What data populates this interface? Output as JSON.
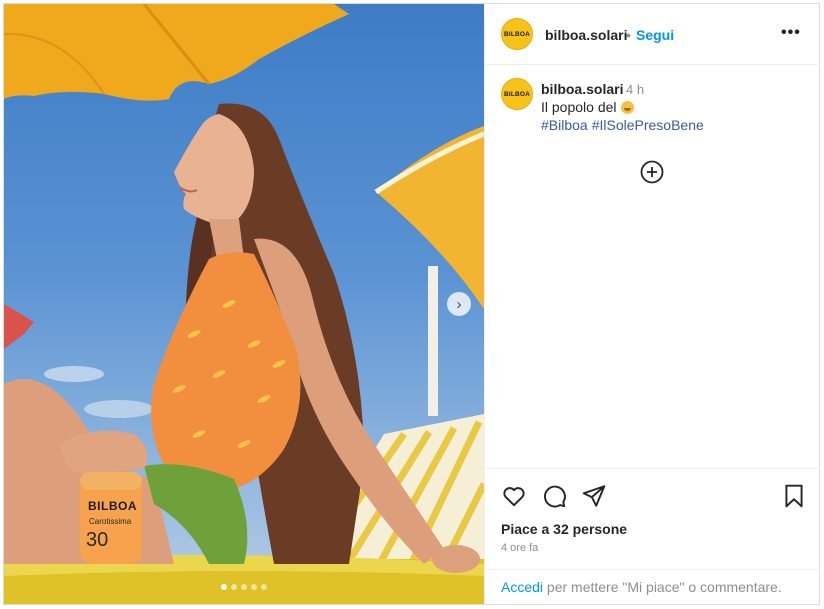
{
  "post": {
    "username": "bilboa.solari",
    "follow_label": "Segui",
    "separator": "•",
    "more_label": "•••",
    "avatar_text": "BILBOA",
    "caption": {
      "username": "bilboa.solari",
      "time": "4 h",
      "text": "Il popolo del",
      "hashtags": [
        "#Bilboa",
        "#IlSolePresoBene"
      ]
    },
    "likes": "Piace a 32 persone",
    "age": "4 ore fa",
    "login": {
      "link": "Accedi",
      "rest": " per mettere \"Mi piace\" o commentare."
    }
  },
  "media": {
    "bottle_brand": "BILBOA",
    "bottle_name": "Carotissima",
    "bottle_spf": "30",
    "carousel_count": 5,
    "carousel_active": 1
  },
  "icons": {
    "next": "chevron-right-icon",
    "add_comment": "plus-circle-icon",
    "like": "heart-icon",
    "comment": "comment-bubble-icon",
    "share": "paper-plane-icon",
    "save": "bookmark-icon"
  },
  "colors": {
    "brand_yellow": "#f7c31b",
    "link_blue": "#0095f6",
    "hashtag_blue": "#385c9e"
  }
}
